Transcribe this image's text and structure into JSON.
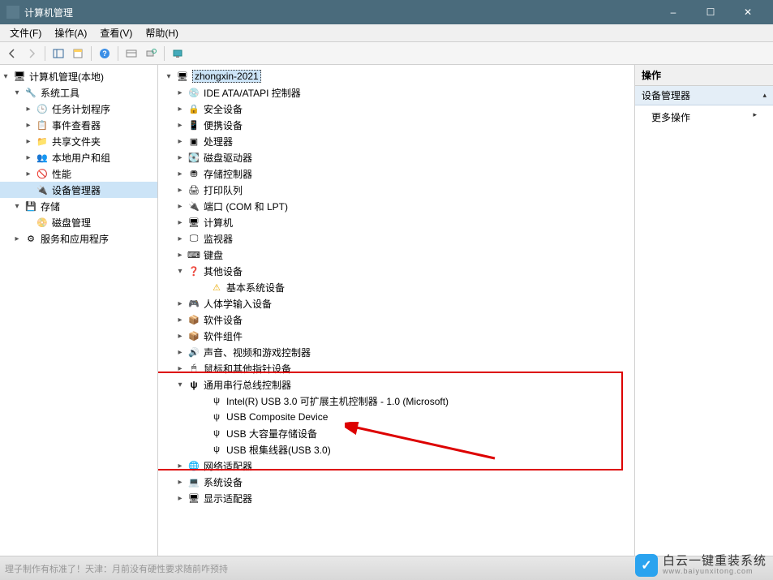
{
  "window": {
    "title": "计算机管理",
    "min": "–",
    "max": "☐",
    "close": "✕"
  },
  "menu": {
    "file": "文件(F)",
    "action": "操作(A)",
    "view": "查看(V)",
    "help": "帮助(H)"
  },
  "left_tree": {
    "root": "计算机管理(本地)",
    "system_tools": "系统工具",
    "task_scheduler": "任务计划程序",
    "event_viewer": "事件查看器",
    "shared_folders": "共享文件夹",
    "local_users": "本地用户和组",
    "performance": "性能",
    "device_manager": "设备管理器",
    "storage": "存储",
    "disk_mgmt": "磁盘管理",
    "services_apps": "服务和应用程序"
  },
  "device_tree": {
    "root": "zhongxin-2021",
    "ide": "IDE ATA/ATAPI 控制器",
    "security": "安全设备",
    "portable": "便携设备",
    "processors": "处理器",
    "disk_drives": "磁盘驱动器",
    "storage_ctrl": "存储控制器",
    "print_queues": "打印队列",
    "ports": "端口 (COM 和 LPT)",
    "computers": "计算机",
    "monitors": "监视器",
    "keyboards": "键盘",
    "other_devices": "其他设备",
    "basic_system_device": "基本系统设备",
    "hid": "人体学输入设备",
    "software_devices": "软件设备",
    "software_components": "软件组件",
    "sound": "声音、视频和游戏控制器",
    "mice": "鼠标和其他指针设备",
    "usb_controllers": "通用串行总线控制器",
    "usb_intel": "Intel(R) USB 3.0 可扩展主机控制器 - 1.0 (Microsoft)",
    "usb_composite": "USB Composite Device",
    "usb_mass_storage": "USB 大容量存储设备",
    "usb_root_hub": "USB 根集线器(USB 3.0)",
    "network_adapters": "网络适配器",
    "system_devices": "系统设备",
    "display_adapters": "显示适配器"
  },
  "right": {
    "header": "操作",
    "section": "设备管理器",
    "more_actions": "更多操作"
  },
  "status": {
    "text_left": "理子制作有标准了！天津：月前没有硬性要求随前咋预持",
    "wm_main": "白云一键重装系统",
    "wm_sub": "www.baiyunxitong.com"
  },
  "colors": {
    "titlebar": "#4a6b7c",
    "selection": "#cce4f7",
    "highlight_box": "#d00"
  }
}
